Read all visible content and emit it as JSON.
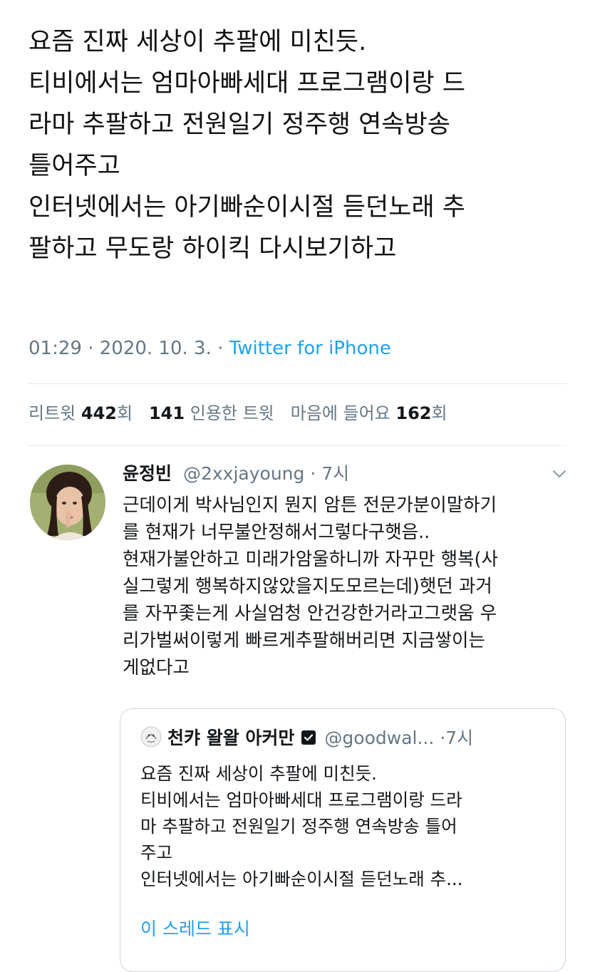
{
  "main_tweet": {
    "lines": [
      "요즘 진짜 세상이 추팔에 미친듯.",
      "티비에서는 엄마아빠세대 프로그램이랑 드",
      "라마 추팔하고 전원일기 정주행 연속방송",
      "틀어주고",
      "인터넷에서는 아기빠순이시절 듣던노래 추",
      "팔하고 무도랑 하이킥 다시보기하고"
    ],
    "time": "01:29",
    "date": "2020. 10. 3.",
    "source": "Twitter for iPhone",
    "sep": "·"
  },
  "stats": {
    "retweet_label": "리트윗",
    "retweet_count": "442",
    "retweet_unit": "회",
    "quote_count": "141",
    "quote_label": "인용한 트윗",
    "like_label": "마음에 들어요",
    "like_count": "162",
    "like_unit": "회"
  },
  "reply": {
    "name": "윤정빈",
    "handle": "@2xxjayoung",
    "time": "· 7시",
    "menu_icon": "chevron-down-icon",
    "lines": [
      "근데이게 박사님인지 뭔지 암튼 전문가분이말하기",
      "를  현재가 너무불안정해서그렇다구햇음..",
      "현재가불안하고 미래가암울하니까 자꾸만 행복(사",
      "실그렇게 행복하지않았을지도모르는데)햇던 과거",
      "를 자꾸좇는게 사실엄청 안건강한거라고그랫움 우",
      "리가벌써이렇게 빠르게추팔해버리면 지금쌓이는",
      "게없다고"
    ],
    "quoted": {
      "name": "천캬 왈왈 아커만",
      "handle": "@goodwal...",
      "time": "·7시",
      "lines": [
        "요즘 진짜 세상이 추팔에 미친듯.",
        "티비에서는 엄마아빠세대 프로그램이랑 드라",
        "마 추팔하고 전원일기 정주행 연속방송 틀어",
        "주고",
        "인터넷에서는 아기빠순이시절 듣던노래 추..."
      ],
      "show_thread": "이 스레드 표시"
    }
  },
  "colors": {
    "link": "#1da1f2",
    "secondary_text": "#657786",
    "primary_text": "#14171a",
    "border": "#ccd6dd"
  }
}
